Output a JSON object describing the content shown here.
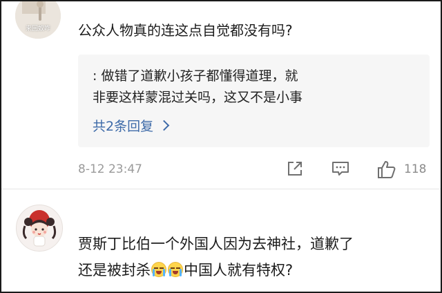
{
  "comment1": {
    "avatar_caption": "来回奴咋",
    "text": "公众人物真的连这点自觉都没有吗?",
    "reply": {
      "line1": ": 做错了道歉小孩子都懂得道理，就",
      "line2": "非要这样蒙混过关吗，这又不是小事"
    },
    "more_replies": "共2条回复",
    "time": "8-12 23:47",
    "like_count": "118"
  },
  "comment2": {
    "line1": "贾斯丁比伯一个外国人因为去神社，道歉了",
    "line2_before": "还是被封杀",
    "emojis": [
      "crying-face-icon",
      "crying-face-icon"
    ],
    "line2_after": "中国人就有特权?"
  },
  "colors": {
    "link": "#3d6aa8",
    "meta": "#9a9a9a",
    "reply_bg": "#f6f6f6"
  }
}
